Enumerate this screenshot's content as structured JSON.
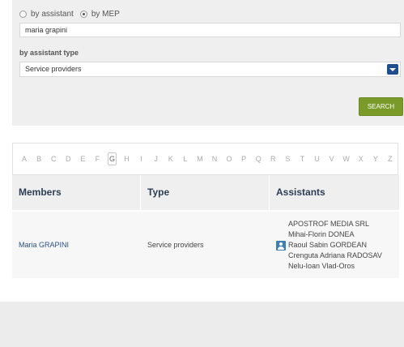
{
  "search": {
    "radio_assistant": "by assistant",
    "radio_mep": "by MEP",
    "selected_radio": "by MEP",
    "name_value": "maria grapini",
    "type_label": "by assistant type",
    "type_selected": "Service providers",
    "search_button": "SEARCH"
  },
  "alphabet": {
    "letters": [
      "A",
      "B",
      "C",
      "D",
      "E",
      "F",
      "G",
      "H",
      "I",
      "J",
      "K",
      "L",
      "M",
      "N",
      "O",
      "P",
      "Q",
      "R",
      "S",
      "T",
      "U",
      "V",
      "W",
      "X",
      "Y",
      "Z"
    ],
    "active": "G"
  },
  "results": {
    "headers": {
      "members": "Members",
      "type": "Type",
      "assistants": "Assistants"
    },
    "rows": [
      {
        "member": "Maria GRAPINI",
        "type": "Service providers",
        "assistants": [
          "APOSTROF MEDIA SRL",
          "Mihai-Florin DONEA",
          "Raoul Sabin GORDEAN",
          "Crenguta Adriana RADOSAV",
          "Nelu-Ioan Vlad-Oros"
        ]
      }
    ]
  },
  "icons": {
    "assistant": "user-card-icon",
    "select": "chevron-down-icon"
  },
  "colors": {
    "search_button": "#7a9b2a",
    "link": "#2a4f86",
    "select_arrow": "#1f4e8c"
  }
}
